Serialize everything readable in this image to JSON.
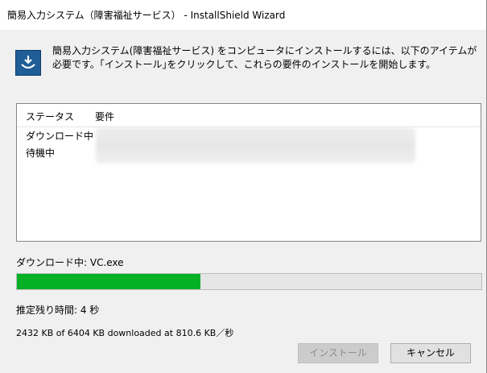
{
  "window": {
    "title": "簡易入力システム（障害福祉サービス） - InstallShield Wizard"
  },
  "header": {
    "icon": "installer-app-icon",
    "message": "簡易入力システム(障害福祉サービス) をコンピュータにインストールするには、以下のアイテムが必要です。｢インストール｣をクリックして、これらの要件のインストールを開始します。"
  },
  "requirements": {
    "columns": {
      "status": "ステータス",
      "requirement": "要件"
    },
    "rows": [
      {
        "status": "ダウンロード中"
      },
      {
        "status": "待機中"
      }
    ]
  },
  "download": {
    "current_label": "ダウンロード中: VC.exe",
    "progress_fraction": 0.395,
    "progress_color": "#06b025",
    "time_remaining": "推定残り時間: 4 秒",
    "bytes_status": "2432 KB of 6404 KB downloaded at 810.6 KB／秒"
  },
  "buttons": {
    "install": "インストール",
    "cancel": "キャンセル"
  }
}
